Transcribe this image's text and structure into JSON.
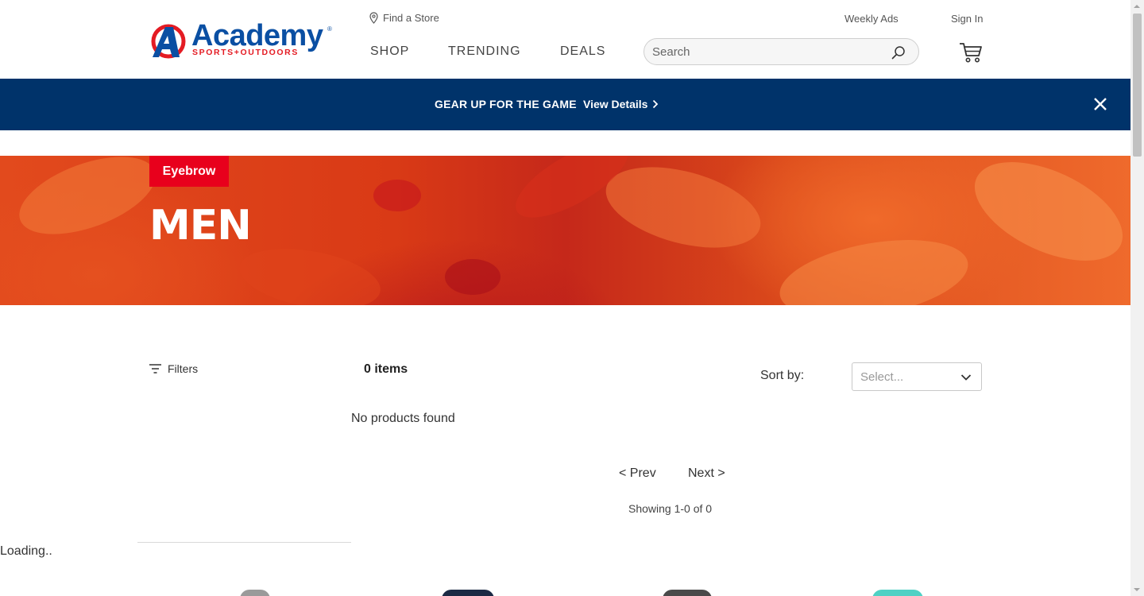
{
  "header": {
    "logo_word": "Academy",
    "logo_sub": "SPORTS+OUTDOORS",
    "find_store": "Find a Store",
    "weekly_ads": "Weekly Ads",
    "sign_in": "Sign In",
    "nav": [
      "SHOP",
      "TRENDING",
      "DEALS"
    ],
    "search_placeholder": "Search"
  },
  "promo": {
    "message": "GEAR UP FOR THE GAME",
    "link": "View Details"
  },
  "hero": {
    "eyebrow": "Eyebrow",
    "title": "MEN"
  },
  "listing": {
    "filters_label": "Filters",
    "item_count": "0 items",
    "sort_label": "Sort by:",
    "sort_value": "Select...",
    "empty_message": "No products found",
    "prev": "< Prev",
    "next": "Next >",
    "showing": "Showing 1-0 of 0",
    "loading": "Loading.."
  },
  "colors": {
    "brand_blue": "#0a4fa3",
    "brand_red": "#e41b23",
    "promo_bg": "#00336a",
    "eyebrow_bg": "#e8001c"
  }
}
